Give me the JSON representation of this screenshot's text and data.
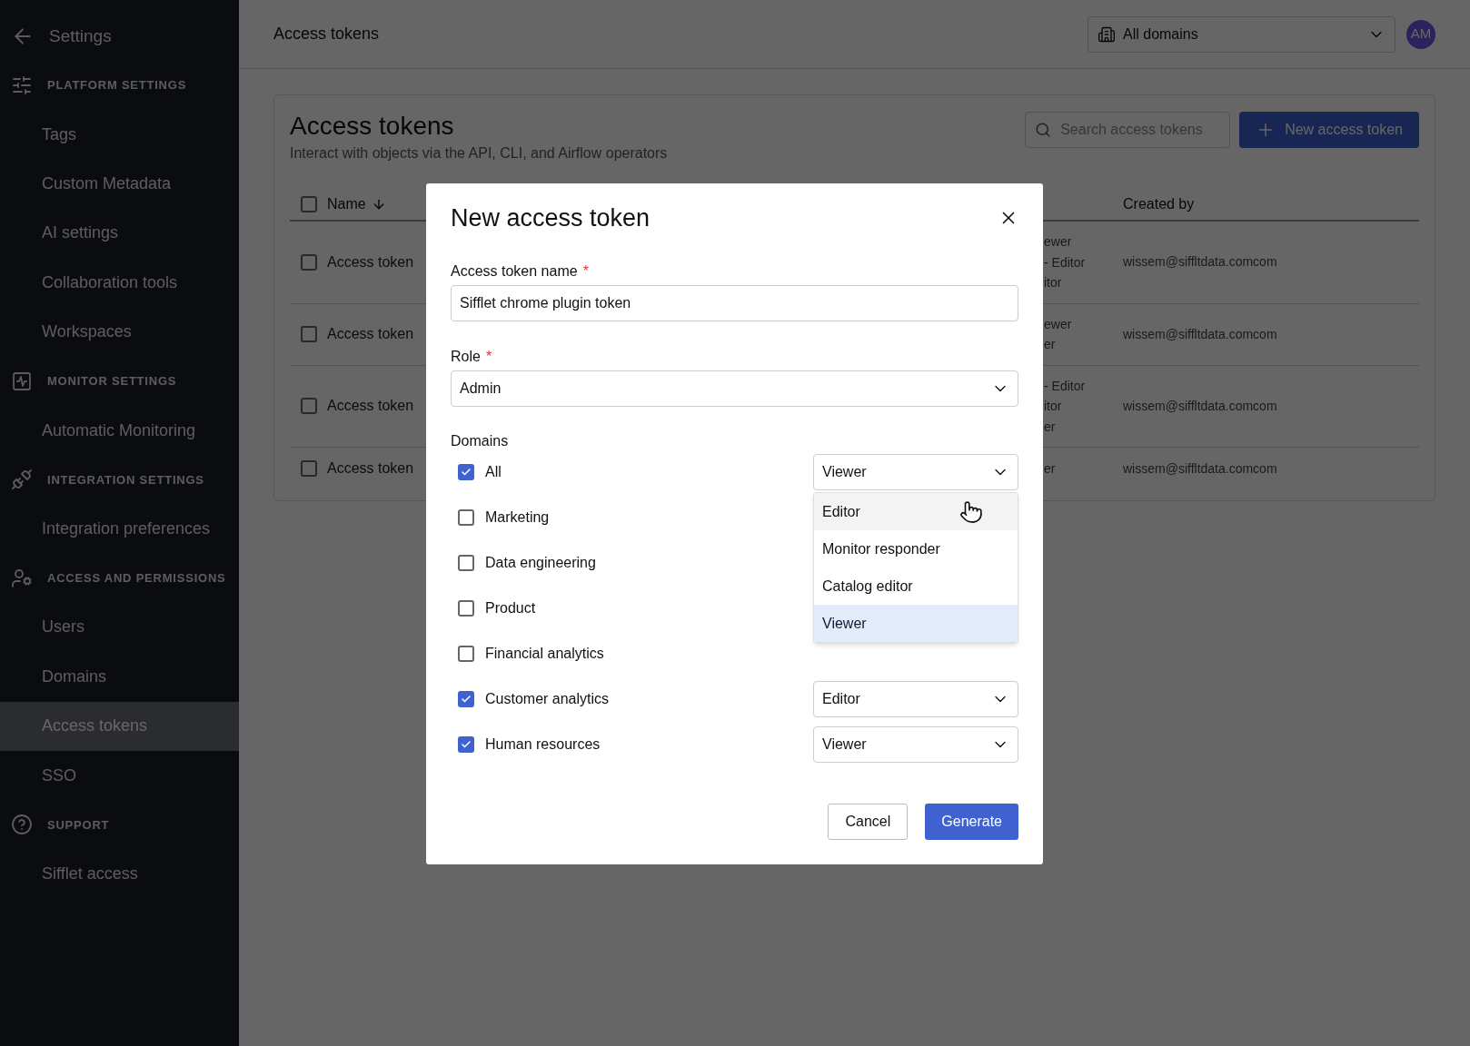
{
  "sidebar": {
    "back_label": "Settings",
    "sections": [
      {
        "title": "PLATFORM SETTINGS",
        "items": [
          {
            "label": "Tags",
            "selected": false
          },
          {
            "label": "Custom Metadata",
            "selected": false
          },
          {
            "label": "AI settings",
            "selected": false
          },
          {
            "label": "Collaboration tools",
            "selected": false
          },
          {
            "label": "Workspaces",
            "selected": false
          }
        ]
      },
      {
        "title": "MONITOR SETTINGS",
        "items": [
          {
            "label": "Automatic Monitoring",
            "selected": false
          }
        ]
      },
      {
        "title": "INTEGRATION SETTINGS",
        "items": [
          {
            "label": "Integration preferences",
            "selected": false
          }
        ]
      },
      {
        "title": "ACCESS AND PERMISSIONS",
        "items": [
          {
            "label": "Users",
            "selected": false
          },
          {
            "label": "Domains",
            "selected": false
          },
          {
            "label": "Access tokens",
            "selected": true
          },
          {
            "label": "SSO",
            "selected": false
          }
        ]
      },
      {
        "title": "SUPPORT",
        "items": [
          {
            "label": "Sifflet access",
            "selected": false
          }
        ]
      }
    ]
  },
  "topbar": {
    "title": "Access tokens",
    "domain_select": "All domains",
    "avatar": "AM"
  },
  "page": {
    "title": "Access tokens",
    "subtitle": "Interact with objects via the API, CLI, and Airflow operators",
    "search": {
      "placeholder": "Search access tokens"
    },
    "new_button": "New access token",
    "table": {
      "all_checked": false,
      "columns": [
        {
          "label": "Name",
          "sorted": true
        },
        {
          "label": "Created by",
          "sorted": false
        }
      ],
      "rows": [
        {
          "checked": false,
          "name": "Access token",
          "roles": [
            "ewer",
            "- Editor",
            "itor"
          ],
          "created_by": "wissem@siffltdata.comcom"
        },
        {
          "checked": false,
          "name": "Access token",
          "roles": [
            "ewer",
            "er"
          ],
          "created_by": "wissem@siffltdata.comcom"
        },
        {
          "checked": false,
          "name": "Access token",
          "roles": [
            "- Editor",
            "itor",
            "er"
          ],
          "created_by": "wissem@siffltdata.comcom"
        },
        {
          "checked": false,
          "name": "Access token",
          "roles": [
            "er"
          ],
          "created_by": "wissem@siffltdata.comcom"
        }
      ]
    }
  },
  "dialog": {
    "title": "New access token",
    "name_field": {
      "label": "Access token name",
      "required_mark": "*",
      "value": "Sifflet chrome plugin token"
    },
    "role_field": {
      "label": "Role",
      "required_mark": "*",
      "value": "Admin"
    },
    "domains_label": "Domains",
    "domains": [
      {
        "label": "All",
        "checked": true,
        "role": "Viewer",
        "menu": [
          {
            "label": "Editor",
            "selected": false,
            "hovered": true
          },
          {
            "label": "Monitor responder",
            "selected": false,
            "hovered": false
          },
          {
            "label": "Catalog editor",
            "selected": false,
            "hovered": false
          },
          {
            "label": "Viewer",
            "selected": true,
            "hovered": false
          }
        ]
      },
      {
        "label": "Marketing",
        "checked": false
      },
      {
        "label": "Data engineering",
        "checked": false
      },
      {
        "label": "Product",
        "checked": false
      },
      {
        "label": "Financial analytics",
        "checked": false
      },
      {
        "label": "Customer analytics",
        "checked": true,
        "role": "Editor"
      },
      {
        "label": "Human resources",
        "checked": true,
        "role": "Viewer"
      }
    ],
    "buttons": [
      {
        "label": "Cancel",
        "kind": "secondary"
      },
      {
        "label": "Generate",
        "kind": "primary"
      }
    ]
  }
}
